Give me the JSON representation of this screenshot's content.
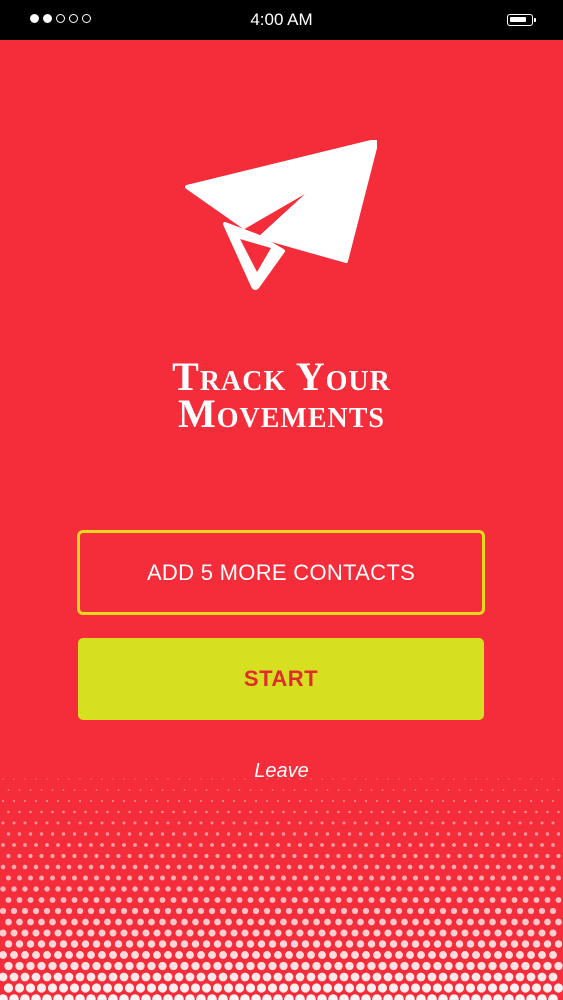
{
  "status_bar": {
    "time": "4:00 AM",
    "signal_dots_filled": 2,
    "signal_dots_total": 5,
    "battery_icon": "battery-icon"
  },
  "logo": {
    "icon": "paper-plane-icon"
  },
  "title": {
    "line1": "Track Your",
    "line2": "Movements"
  },
  "buttons": {
    "add_contacts_label": "ADD 5 MORE CONTACTS",
    "start_label": "START",
    "leave_label": "Leave"
  },
  "colors": {
    "background": "#f52c3a",
    "accent_yellow": "#d6e020",
    "outline_yellow": "#e7d81e",
    "start_text": "#e02c2c"
  }
}
